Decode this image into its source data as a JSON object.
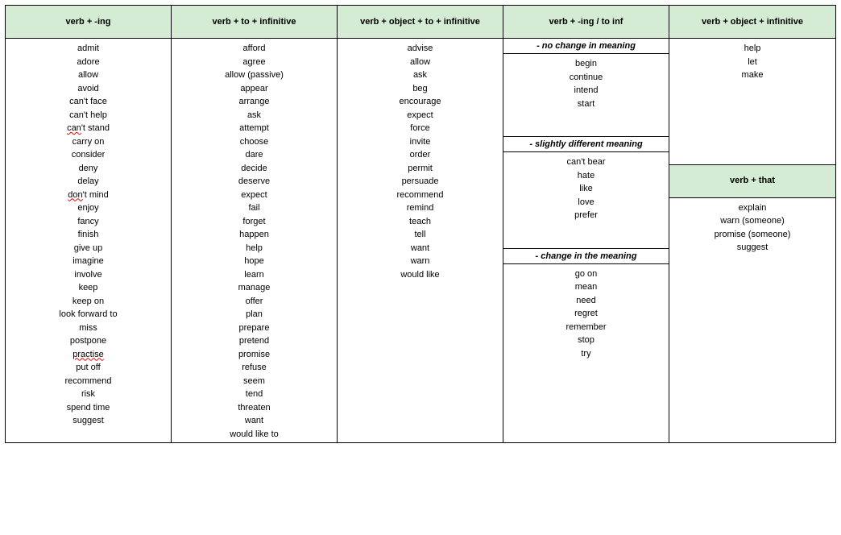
{
  "headers": {
    "col1": "verb + -ing",
    "col2": "verb + to + infinitive",
    "col3": "verb + object + to + infinitive",
    "col4": "verb + -ing / to inf",
    "col5a": "verb + object + infinitive",
    "col5b": "verb + that"
  },
  "subheaders": {
    "s1": "- no change in meaning",
    "s2": "- slightly different meaning",
    "s3": "- change in the meaning"
  },
  "col1_words": [
    "admit",
    "adore",
    "allow",
    "avoid",
    "can't face",
    "can't help",
    "can't stand",
    "carry on",
    "consider",
    "deny",
    "delay",
    "don't mind",
    "enjoy",
    "fancy",
    "finish",
    "give up",
    "imagine",
    "involve",
    "keep",
    "keep on",
    "look forward to",
    "miss",
    "postpone",
    "practise",
    "put off",
    "recommend",
    "risk",
    "spend time",
    "suggest"
  ],
  "col2_words": [
    "afford",
    "agree",
    "allow (passive)",
    "appear",
    "arrange",
    "ask",
    "attempt",
    "choose",
    "dare",
    "decide",
    "deserve",
    "expect",
    "fail",
    "forget",
    "happen",
    "help",
    "hope",
    "learn",
    "manage",
    "offer",
    "plan",
    "prepare",
    "pretend",
    "promise",
    "refuse",
    "seem",
    "tend",
    "threaten",
    "want",
    "would like to"
  ],
  "col3_words": [
    "advise",
    "allow",
    "ask",
    "beg",
    "encourage",
    "expect",
    "force",
    "invite",
    "order",
    "permit",
    "persuade",
    "recommend",
    "remind",
    "teach",
    "tell",
    "want",
    "warn",
    "would like"
  ],
  "col4_g1": [
    "begin",
    "continue",
    "intend",
    "start"
  ],
  "col4_g2": [
    "can't bear",
    "hate",
    "like",
    "love",
    "prefer"
  ],
  "col4_g3": [
    "go on",
    "mean",
    "need",
    "regret",
    "remember",
    "stop",
    "try"
  ],
  "col5_g1": [
    "help",
    "let",
    "make"
  ],
  "col5_g2": [
    "explain",
    "warn (someone)",
    "promise (someone)",
    "suggest"
  ],
  "squiggle_words": [
    "can't stand",
    "don't mind",
    "practise"
  ]
}
